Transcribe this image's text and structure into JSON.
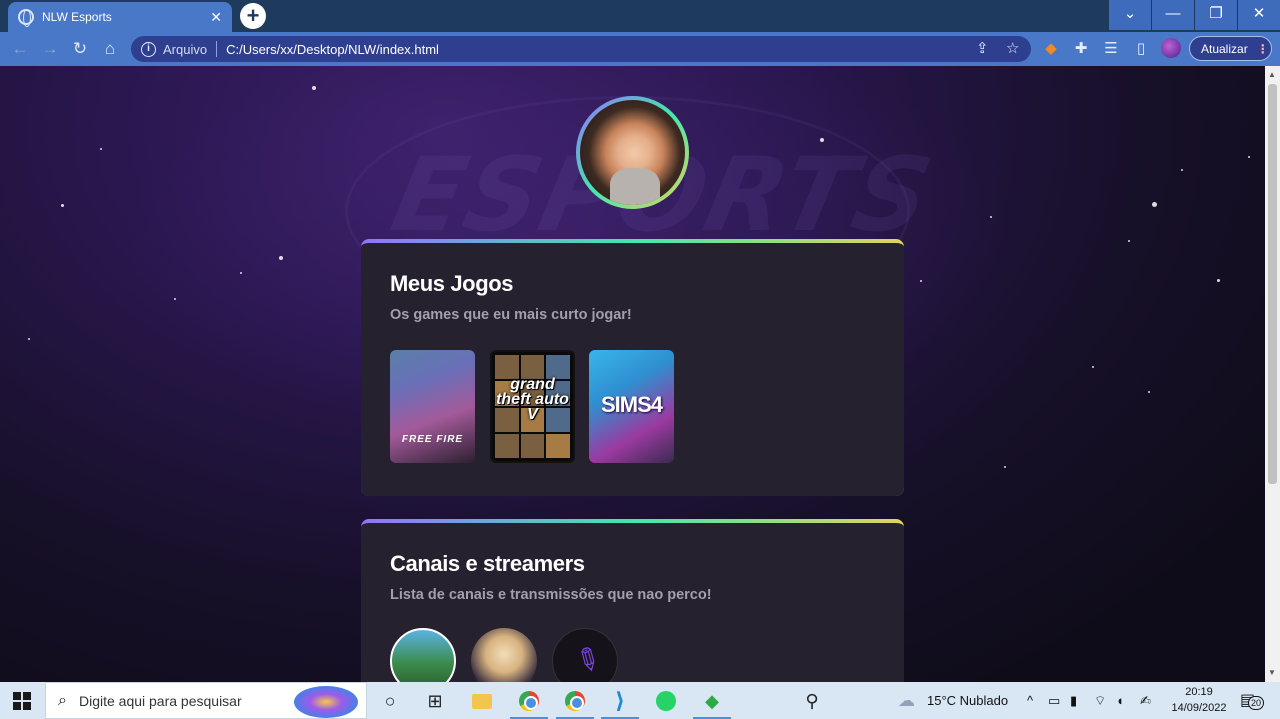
{
  "browser": {
    "tab_title": "NLW Esports",
    "tab_close": "✕",
    "new_tab": "+",
    "window_controls": [
      "⌄",
      "—",
      "❐",
      "✕"
    ],
    "nav": {
      "back": "←",
      "forward": "→",
      "reload": "↻",
      "home": "⌂"
    },
    "address": {
      "scheme_label": "Arquivo",
      "url": "C:/Users/xx/Desktop/NLW/index.html",
      "info_icon": "i"
    },
    "toolbar_icons": [
      "share-icon",
      "star-icon",
      "metamask-fox-icon",
      "extensions-icon",
      "media-queue-icon",
      "sidepanel-icon"
    ],
    "update_button": "Atualizar",
    "update_menu": "⋮"
  },
  "page": {
    "background_word": "ESPORTS",
    "sections": [
      {
        "title": "Meus Jogos",
        "subtitle": "Os games que eu mais curto jogar!",
        "games": [
          {
            "label": "FREE FIRE",
            "name": "free-fire"
          },
          {
            "label": "grand theft auto V",
            "name": "gta-v"
          },
          {
            "label": "SIMS4",
            "name": "sims-4"
          }
        ]
      },
      {
        "title": "Canais e streamers",
        "subtitle": "Lista de canais e transmissões que nao perco!"
      }
    ]
  },
  "taskbar": {
    "search_placeholder": "Digite aqui para pesquisar",
    "weather": "15°C  Nublado",
    "time": "20:19",
    "date": "14/09/2022",
    "notifications": "20"
  },
  "colors": {
    "gradient_start": "#9572fc",
    "gradient_mid": "#43e7ad",
    "gradient_end": "#e2d45c",
    "card_bg": "#25212f"
  }
}
